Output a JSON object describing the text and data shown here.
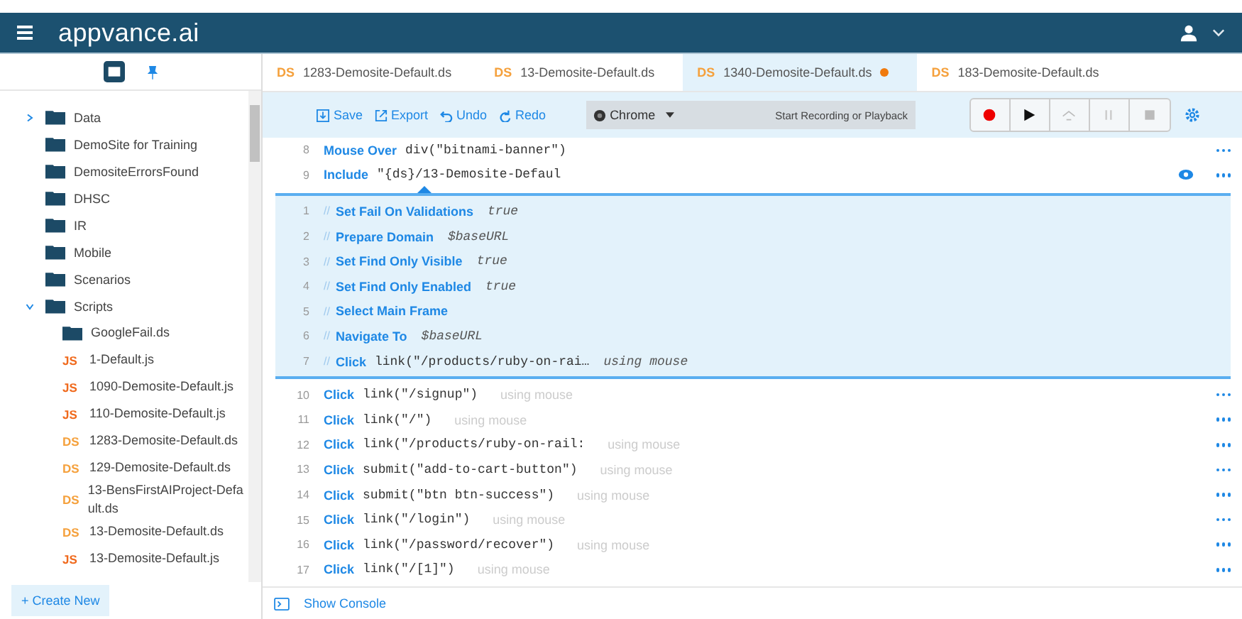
{
  "header": {
    "logo": "appvance.ai"
  },
  "sidebar": {
    "tree": [
      {
        "label": "Data",
        "kind": "group",
        "expanded": false
      },
      {
        "label": "DemoSite for Training",
        "kind": "folder"
      },
      {
        "label": "DemositeErrorsFound",
        "kind": "folder"
      },
      {
        "label": "DHSC",
        "kind": "folder"
      },
      {
        "label": "IR",
        "kind": "folder"
      },
      {
        "label": "Mobile",
        "kind": "folder"
      },
      {
        "label": "Scenarios",
        "kind": "folder"
      },
      {
        "label": "Scripts",
        "kind": "group",
        "expanded": true,
        "children": [
          {
            "label": "GoogleFail.ds",
            "kind": "folder"
          },
          {
            "label": "1-Default.js",
            "kind": "js",
            "badge": "JS"
          },
          {
            "label": "1090-Demosite-Default.js",
            "kind": "js",
            "badge": "JS"
          },
          {
            "label": "110-Demosite-Default.js",
            "kind": "js",
            "badge": "JS"
          },
          {
            "label": "1283-Demosite-Default.ds",
            "kind": "ds",
            "badge": "DS"
          },
          {
            "label": "129-Demosite-Default.ds",
            "kind": "ds",
            "badge": "DS"
          },
          {
            "label": "13-BensFirstAIProject-Default.ds",
            "kind": "ds",
            "badge": "DS"
          },
          {
            "label": "13-Demosite-Default.ds",
            "kind": "ds",
            "badge": "DS"
          },
          {
            "label": "13-Demosite-Default.js",
            "kind": "js",
            "badge": "JS"
          }
        ]
      }
    ],
    "create_button": "+ Create New"
  },
  "tabs": [
    {
      "badge": "DS",
      "label": "1283-Demosite-Default.ds",
      "selected": false,
      "modified": false
    },
    {
      "badge": "DS",
      "label": "13-Demosite-Default.ds",
      "selected": false,
      "modified": false
    },
    {
      "badge": "DS",
      "label": "1340-Demosite-Default.ds",
      "selected": true,
      "modified": true
    },
    {
      "badge": "DS",
      "label": "183-Demosite-Default.ds",
      "selected": false,
      "modified": false
    }
  ],
  "toolbar": {
    "actions": [
      {
        "kind": "save",
        "label": "Save"
      },
      {
        "kind": "export",
        "label": "Export"
      },
      {
        "kind": "undo",
        "label": "Undo"
      },
      {
        "kind": "redo",
        "label": "Redo"
      }
    ],
    "browser": "Chrome",
    "status": "Start Recording or Playback",
    "controls": [
      {
        "kind": "record",
        "disabled": false
      },
      {
        "kind": "play",
        "disabled": false
      },
      {
        "kind": "step",
        "disabled": true
      },
      {
        "kind": "pause",
        "disabled": true
      },
      {
        "kind": "stop",
        "disabled": true
      }
    ]
  },
  "script": {
    "lines_before": [
      {
        "number": "8",
        "command": "Mouse Over",
        "argument": "div(\"bitnami-banner\")",
        "eye": false
      },
      {
        "number": "9",
        "command": "Include",
        "argument": "\"{ds}/13-Demosite-Defaul",
        "eye": true
      }
    ],
    "included": [
      {
        "number": "1",
        "mark": "//",
        "command": "Set Fail On Validations",
        "modifier": "true"
      },
      {
        "number": "2",
        "mark": "//",
        "command": "Prepare Domain",
        "modifier": "$baseURL"
      },
      {
        "number": "3",
        "mark": "//",
        "command": "Set Find Only Visible",
        "modifier": "true"
      },
      {
        "number": "4",
        "mark": "//",
        "command": "Set Find Only Enabled",
        "modifier": "true"
      },
      {
        "number": "5",
        "mark": "//",
        "command": "Select Main Frame"
      },
      {
        "number": "6",
        "mark": "//",
        "command": "Navigate To",
        "modifier": "$baseURL"
      },
      {
        "number": "7",
        "mark": "//",
        "command": "Click",
        "argument": "link(\"/products/ruby-on-rai…",
        "modifier": "using mouse"
      }
    ],
    "lines_after": [
      {
        "number": "10",
        "command": "Click",
        "argument": "link(\"/signup\")",
        "modifier": "using mouse",
        "eye": false
      },
      {
        "number": "11",
        "command": "Click",
        "argument": "link(\"/\")",
        "modifier": "using mouse",
        "eye": false
      },
      {
        "number": "12",
        "command": "Click",
        "argument": "link(\"/products/ruby-on-rail:",
        "modifier": "using mouse",
        "eye": false
      },
      {
        "number": "13",
        "command": "Click",
        "argument": "submit(\"add-to-cart-button\")",
        "modifier": "using mouse",
        "eye": false
      },
      {
        "number": "14",
        "command": "Click",
        "argument": "submit(\"btn btn-success\")",
        "modifier": "using mouse",
        "eye": false
      },
      {
        "number": "15",
        "command": "Click",
        "argument": "link(\"/login\")",
        "modifier": "using mouse",
        "eye": false
      },
      {
        "number": "16",
        "command": "Click",
        "argument": "link(\"/password/recover\")",
        "modifier": "using mouse",
        "eye": false
      },
      {
        "number": "17",
        "command": "Click",
        "argument": "link(\"/[1]\")",
        "modifier": "using mouse",
        "eye": false
      }
    ]
  },
  "console_button": "Show Console"
}
